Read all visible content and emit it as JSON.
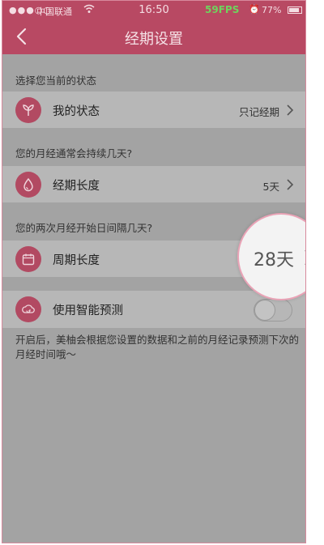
{
  "status_bar": {
    "signal": "●●●○○",
    "carrier": "中国联通",
    "wifi_icon": "wifi-icon",
    "time": "16:50",
    "fps": "59FPS",
    "alarm_icon": "alarm-icon",
    "battery": "77%",
    "battery_icon": "battery-icon"
  },
  "header": {
    "title": "经期设置",
    "back_icon": "chevron-left-icon",
    "color": "#b84963"
  },
  "sections": {
    "state_title": "选择您当前的状态",
    "period_title": "您的月经通常会持续几天?",
    "cycle_title": "您的两次月经开始日间隔几天?"
  },
  "rows": {
    "my_state": {
      "icon": "sprout-icon",
      "label": "我的状态",
      "value": "只记经期"
    },
    "period_length": {
      "icon": "drop-icon",
      "label": "经期长度",
      "value": "5天"
    },
    "cycle_length": {
      "icon": "calendar-icon",
      "label": "周期长度",
      "value": "28天"
    },
    "smart_predict": {
      "icon": "cloud-refresh-icon",
      "label": "使用智能预测",
      "enabled": false
    }
  },
  "note": "开启后，美柚会根据您设置的数据和之前的月经记录预测下次的月经时间哦～",
  "magnifier": {
    "value": "28天"
  },
  "colors": {
    "accent": "#b24a62",
    "overlay": "#a3a3a3",
    "row": "#b7b7b7"
  }
}
